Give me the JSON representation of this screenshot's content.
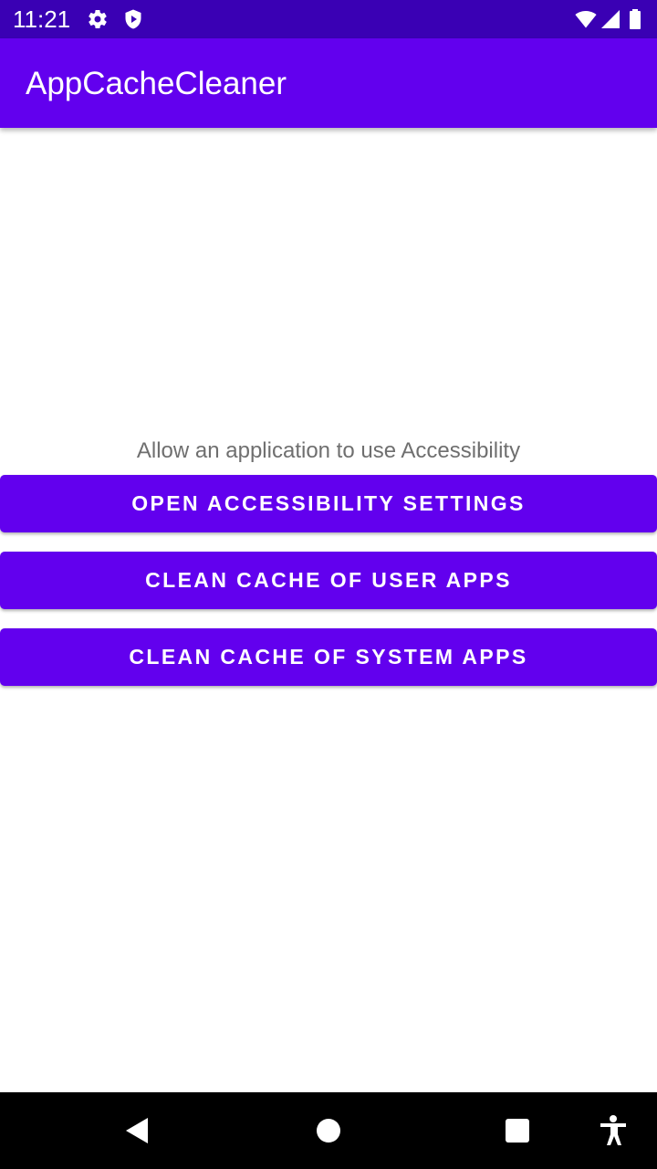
{
  "status_bar": {
    "time": "11:21",
    "icons": [
      "settings-icon",
      "shield-icon",
      "wifi-icon",
      "signal-icon",
      "battery-icon"
    ]
  },
  "app_bar": {
    "title": "AppCacheCleaner"
  },
  "main": {
    "instruction": "Allow an application to use Accessibility",
    "buttons": [
      {
        "label": "OPEN ACCESSIBILITY SETTINGS"
      },
      {
        "label": "CLEAN CACHE OF USER APPS"
      },
      {
        "label": "CLEAN CACHE OF SYSTEM APPS"
      }
    ]
  },
  "nav_bar": {
    "icons": [
      "back-icon",
      "home-icon",
      "recents-icon",
      "accessibility-icon"
    ]
  },
  "colors": {
    "status_bar": "#3a00b4",
    "primary": "#6200ee",
    "instruction_text": "#6f6f6f"
  }
}
